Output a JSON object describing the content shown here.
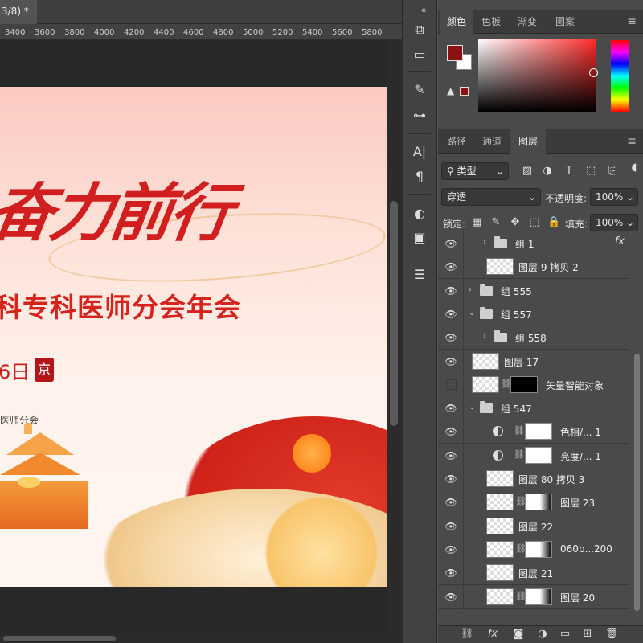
{
  "document": {
    "tab_title": "3/8) *"
  },
  "ruler": {
    "ticks": [
      "3400",
      "3600",
      "3800",
      "4000",
      "4200",
      "4400",
      "4600",
      "4800",
      "5000",
      "5200",
      "5400",
      "5600",
      "5800"
    ]
  },
  "artwork": {
    "headline": "奋力前行",
    "subtitle": "科专科医师分会年会",
    "date": "6日",
    "seal": "京",
    "org": "医师分会"
  },
  "color_panel": {
    "tabs": [
      "颜色",
      "色板",
      "渐变",
      "图案"
    ],
    "foreground": "#8b1212",
    "background": "#ffffff"
  },
  "layers_panel": {
    "tabs": [
      "路径",
      "通道",
      "图层"
    ],
    "filter_kind": "类型",
    "blend_mode": "穿透",
    "opacity_label": "不透明度:",
    "opacity_value": "100%",
    "lock_label": "锁定:",
    "fill_label": "填充:",
    "fill_value": "100%",
    "layers": [
      {
        "name": "组 1",
        "type": "group",
        "collapsed": true,
        "indent": 1,
        "visible": true,
        "fx": "fx"
      },
      {
        "name": "图层 9 拷贝 2",
        "type": "pixel",
        "indent": 1,
        "visible": true
      },
      {
        "name": "组 555",
        "type": "group",
        "collapsed": true,
        "indent": 0,
        "visible": true
      },
      {
        "name": "组 557",
        "type": "group",
        "collapsed": false,
        "indent": 0,
        "visible": true
      },
      {
        "name": "组 558",
        "type": "group",
        "collapsed": true,
        "indent": 1,
        "visible": true
      },
      {
        "name": "图层 17",
        "type": "pixel",
        "indent": 0,
        "visible": true
      },
      {
        "name": "矢量智能对象",
        "type": "smart-masked",
        "indent": 0,
        "visible": false
      },
      {
        "name": "组 547",
        "type": "group",
        "collapsed": false,
        "indent": 0,
        "visible": true
      },
      {
        "name": "色相/... 1",
        "type": "adjustment",
        "indent": 1,
        "visible": true
      },
      {
        "name": "亮度/... 1",
        "type": "adjustment",
        "indent": 1,
        "visible": true
      },
      {
        "name": "图层 80 拷贝 3",
        "type": "pixel",
        "indent": 1,
        "visible": true
      },
      {
        "name": "图层 23",
        "type": "masked",
        "indent": 1,
        "visible": true
      },
      {
        "name": "图层 22",
        "type": "pixel",
        "indent": 1,
        "visible": true
      },
      {
        "name": "060b...200",
        "type": "masked",
        "indent": 1,
        "visible": true
      },
      {
        "name": "图层 21",
        "type": "pixel",
        "indent": 1,
        "visible": true
      },
      {
        "name": "图层 20",
        "type": "masked",
        "indent": 1,
        "visible": true
      }
    ]
  }
}
